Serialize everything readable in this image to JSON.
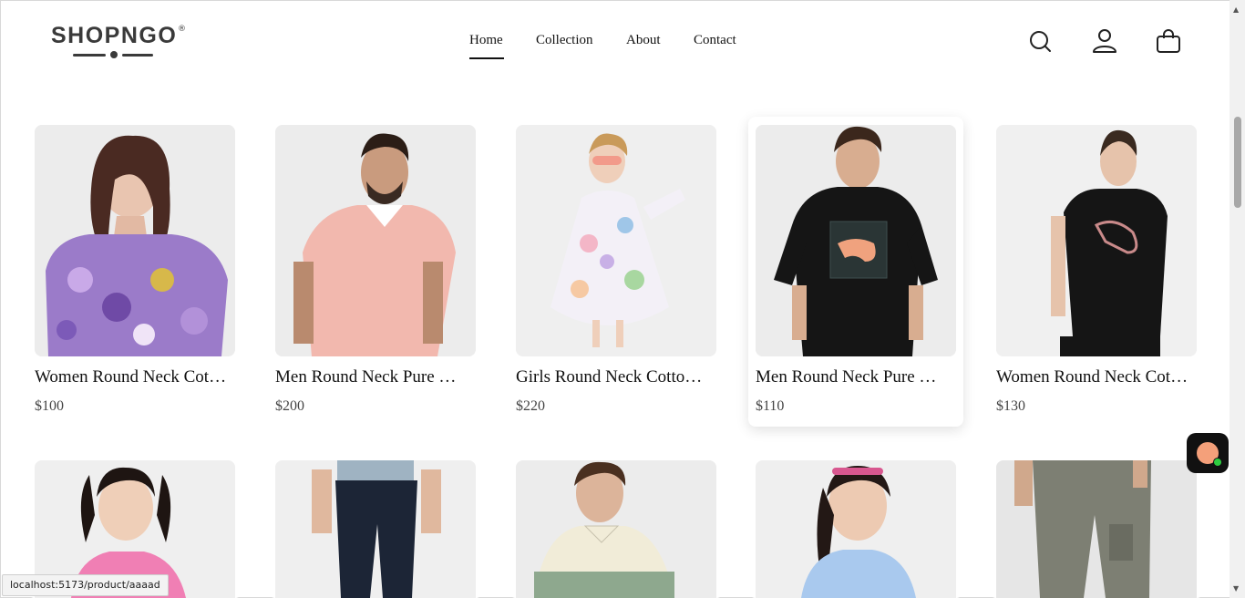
{
  "header": {
    "logo_text": "SHOPNGO",
    "logo_mark": "®",
    "nav": [
      {
        "label": "Home",
        "active": true
      },
      {
        "label": "Collection",
        "active": false
      },
      {
        "label": "About",
        "active": false
      },
      {
        "label": "Contact",
        "active": false
      }
    ],
    "icons": [
      "search-icon",
      "user-icon",
      "shopping-bag-icon"
    ]
  },
  "products": [
    {
      "title": "Women Round Neck Cot…",
      "price": "$100"
    },
    {
      "title": "Men Round Neck Pure …",
      "price": "$200"
    },
    {
      "title": "Girls Round Neck Cotto…",
      "price": "$220"
    },
    {
      "title": "Men Round Neck Pure …",
      "price": "$110"
    },
    {
      "title": "Women Round Neck Cot…",
      "price": "$130"
    }
  ],
  "status_bar": {
    "url": "localhost:5173/product/aaaad"
  },
  "colors": {
    "accent": "#111111",
    "background": "#ffffff",
    "thumb_bg": "#efefef"
  }
}
